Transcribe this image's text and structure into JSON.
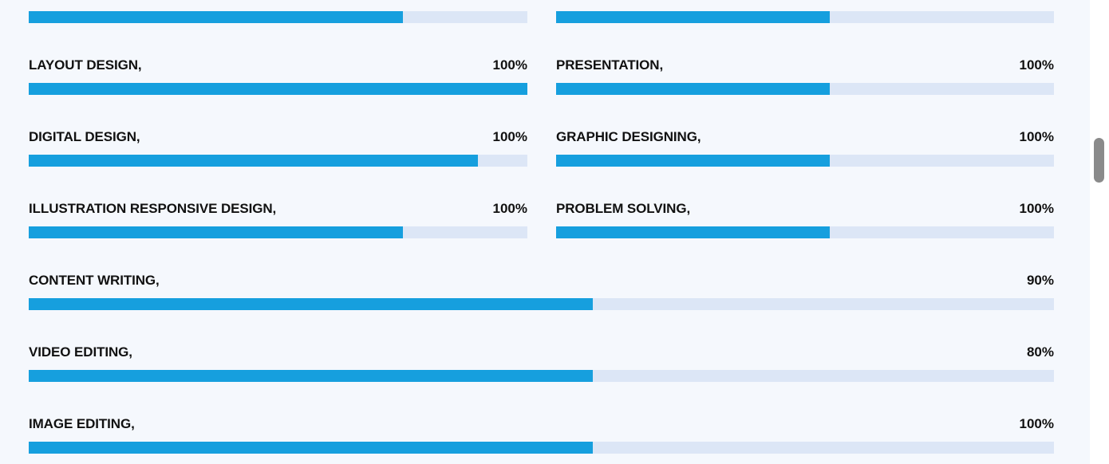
{
  "skills": {
    "partial_left_bar": {
      "fill_fraction": 0.75
    },
    "partial_right_bar": {
      "fill_fraction": 0.55
    },
    "items": [
      {
        "name": "LAYOUT DESIGN,",
        "percent": "100%",
        "fill_fraction": 1.0
      },
      {
        "name": "PRESENTATION,",
        "percent": "100%",
        "fill_fraction": 0.55
      },
      {
        "name": "DIGITAL DESIGN,",
        "percent": "100%",
        "fill_fraction": 0.9
      },
      {
        "name": "GRAPHIC DESIGNING,",
        "percent": "100%",
        "fill_fraction": 0.55
      },
      {
        "name": "ILLUSTRATION RESPONSIVE DESIGN,",
        "percent": "100%",
        "fill_fraction": 0.75
      },
      {
        "name": "PROBLEM SOLVING,",
        "percent": "100%",
        "fill_fraction": 0.55
      },
      {
        "name": "CONTENT WRITING,",
        "percent": "90%",
        "fill_fraction": 0.55
      },
      {
        "name": "VIDEO EDITING,",
        "percent": "80%",
        "fill_fraction": 0.55
      },
      {
        "name": "IMAGE EDITING,",
        "percent": "100%",
        "fill_fraction": 0.55
      }
    ]
  },
  "colors": {
    "bar_fill": "#169fde",
    "bar_track": "#dce6f6",
    "background": "#f5f8fd",
    "text": "#111111"
  }
}
